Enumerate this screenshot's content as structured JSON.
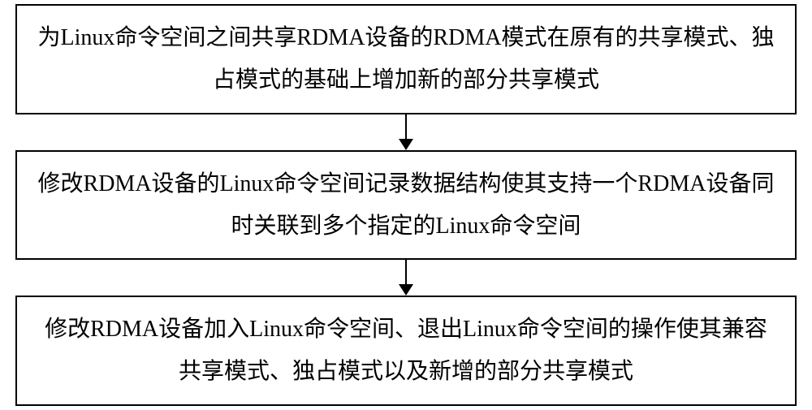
{
  "flowchart": {
    "box1": "为Linux命令空间之间共享RDMA设备的RDMA模式在原有的共享模式、独占模式的基础上增加新的部分共享模式",
    "box2": "修改RDMA设备的Linux命令空间记录数据结构使其支持一个RDMA设备同时关联到多个指定的Linux命令空间",
    "box3": "修改RDMA设备加入Linux命令空间、退出Linux命令空间的操作使其兼容共享模式、独占模式以及新增的部分共享模式"
  }
}
